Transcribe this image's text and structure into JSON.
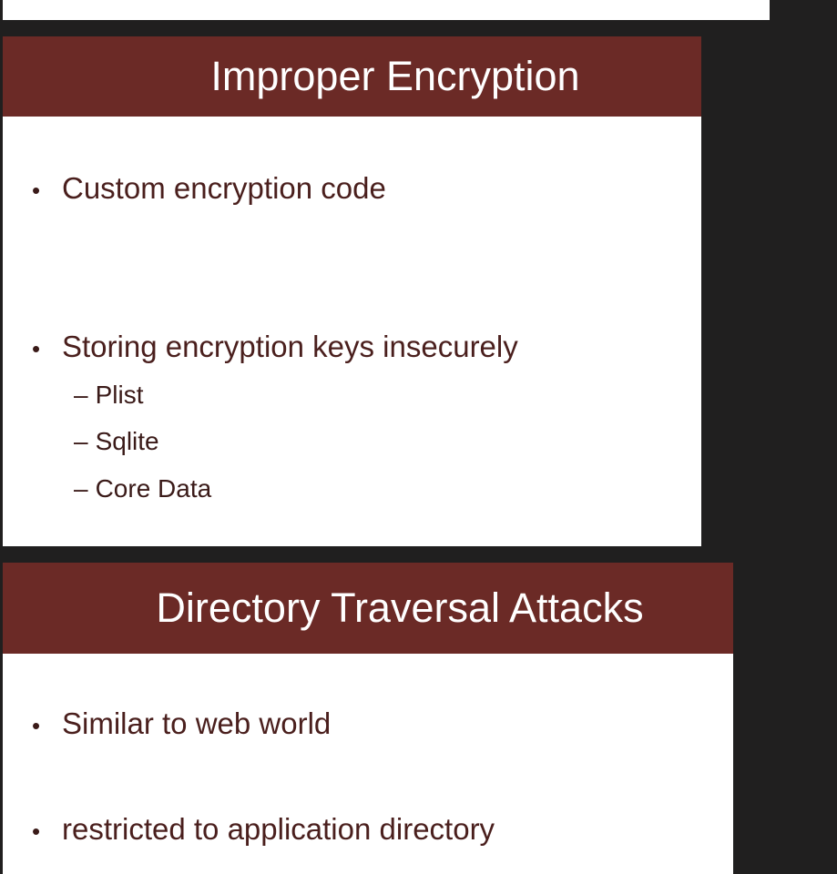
{
  "slides": [
    {
      "title": "Improper Encryption",
      "bullets": [
        {
          "text": "Custom encryption code",
          "subs": []
        },
        {
          "text": "Storing encryption keys insecurely",
          "subs": [
            "Plist",
            "Sqlite",
            "Core Data"
          ]
        }
      ]
    },
    {
      "title": "Directory Traversal Attacks",
      "bullets": [
        {
          "text": "Similar to web world",
          "subs": []
        },
        {
          "text": "restricted to application directory",
          "subs": []
        }
      ]
    }
  ],
  "glyphs": {
    "bullet": "•",
    "dash": "–"
  },
  "colors": {
    "title_bar": "#6b2a26",
    "background": "#201f1f",
    "text": "#4a1f1d"
  }
}
